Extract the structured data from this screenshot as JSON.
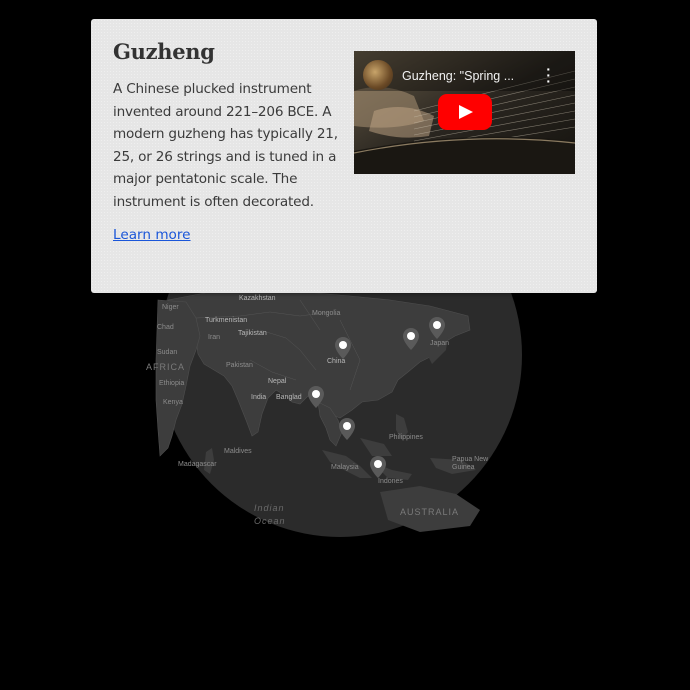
{
  "card": {
    "title": "Guzheng",
    "description": "A Chinese plucked instrument invented around 221–206 BCE. A modern guzheng has typically 21, 25, or 26 strings and is tuned in a major pentatonic scale. The instrument is often decorated.",
    "learn_more": "Learn more",
    "video": {
      "title": "Guzheng: \"Spring ...",
      "more_icon": "more-vert-icon",
      "play_icon": "youtube-play-icon"
    }
  },
  "map": {
    "labels": {
      "niger": "Niger",
      "chad": "Chad",
      "sudan": "Sudan",
      "africa": "AFRICA",
      "ethiopia": "Ethiopia",
      "kenya": "Kenya",
      "madagascar": "Madagascar",
      "kazakhstan": "Kazakhstan",
      "turkmenistan": "Turkmenistan",
      "tajikistan": "Tajikistan",
      "iran": "Iran",
      "pakistan": "Pakistan",
      "nepal": "Nepal",
      "india": "India",
      "bangladesh": "Banglad",
      "china": "China",
      "maldives": "Maldives",
      "philippines": "Philippines",
      "malaysia": "Malaysia",
      "indonesia": "Indones",
      "papua": "Papua New Guinea",
      "australia": "AUSTRALIA",
      "indian_ocean_1": "Indian",
      "indian_ocean_2": "Ocean",
      "mongolia": "Mongolia",
      "japan": "Japan"
    },
    "pin_count": 6
  },
  "colors": {
    "background": "#000000",
    "globe": "#2d2d2d",
    "land": "#3a3a3a",
    "card": "#e6e6e6",
    "link": "#1a56d9",
    "youtube_red": "#ff0000"
  }
}
